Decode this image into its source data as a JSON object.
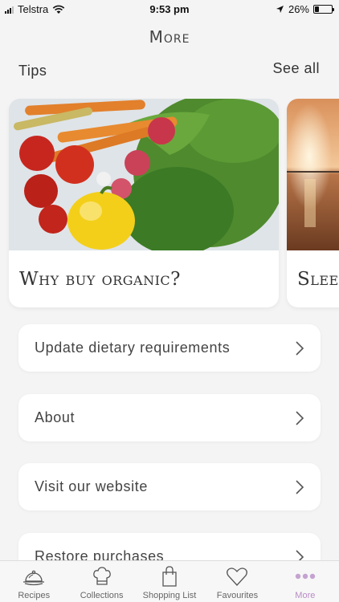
{
  "status": {
    "carrier": "Telstra",
    "time": "9:53 pm",
    "battery": "26%",
    "battery_level": 0.26
  },
  "header": {
    "title": "More"
  },
  "tips": {
    "heading": "Tips",
    "see_all": "See all",
    "cards": [
      {
        "title": "Why buy organic?"
      },
      {
        "title": "Sleep"
      }
    ]
  },
  "menu": {
    "items": [
      {
        "label": "Update dietary requirements"
      },
      {
        "label": "About"
      },
      {
        "label": "Visit our website"
      },
      {
        "label": "Restore purchases"
      }
    ]
  },
  "tabbar": {
    "active_color": "#b78bc4",
    "tabs": [
      {
        "label": "Recipes",
        "icon": "cloche-icon"
      },
      {
        "label": "Collections",
        "icon": "chef-hat-icon"
      },
      {
        "label": "Shopping List",
        "icon": "shopping-bag-icon"
      },
      {
        "label": "Favourites",
        "icon": "heart-icon"
      },
      {
        "label": "More",
        "icon": "more-dots-icon"
      }
    ]
  }
}
